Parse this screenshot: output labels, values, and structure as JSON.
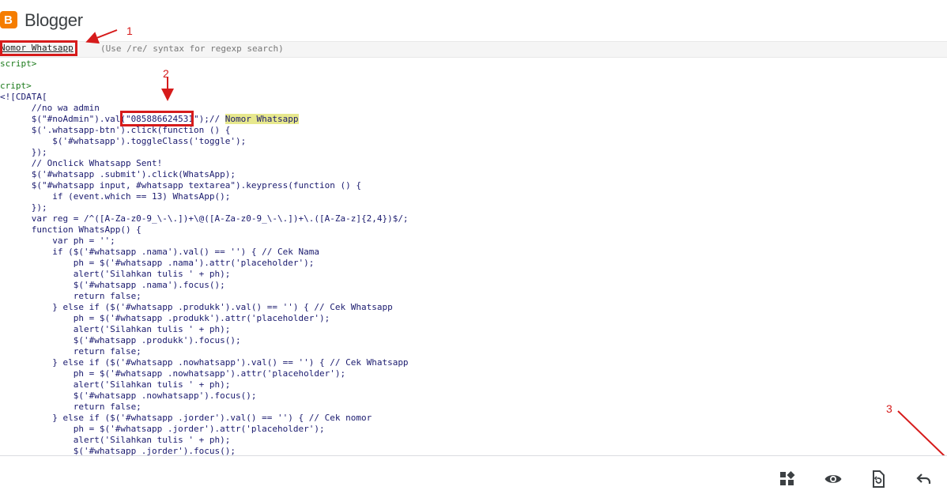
{
  "header": {
    "app_title": "Blogger",
    "logo_letter": "B"
  },
  "search": {
    "value": "Nomor Whatsapp",
    "hint": "(Use /re/ syntax for regexp search)"
  },
  "annotations": {
    "label_1": "1",
    "label_2": "2",
    "label_3": "3",
    "color": "#d61b1b"
  },
  "code_lines": [
    "script>",
    "",
    "cript>",
    "<![CDATA[",
    "      //no wa admin",
    "      $(\"#noAdmin\").val(\"085886624531\");// ",
    "      $('.whatsapp-btn').click(function () {",
    "          $('#whatsapp').toggleClass('toggle');",
    "      });",
    "      // Onclick Whatsapp Sent!",
    "      $('#whatsapp .submit').click(WhatsApp);",
    "      $(\"#whatsapp input, #whatsapp textarea\").keypress(function () {",
    "          if (event.which == 13) WhatsApp();",
    "      });",
    "      var reg = /^([A-Za-z0-9_\\-\\.])+\\@([A-Za-z0-9_\\-\\.])+\\.([A-Za-z]{2,4})$/;",
    "      function WhatsApp() {",
    "          var ph = '';",
    "          if ($('#whatsapp .nama').val() == '') { // Cek Nama",
    "              ph = $('#whatsapp .nama').attr('placeholder');",
    "              alert('Silahkan tulis ' + ph);",
    "              $('#whatsapp .nama').focus();",
    "              return false;",
    "          } else if ($('#whatsapp .produkk').val() == '') { // Cek Whatsapp",
    "              ph = $('#whatsapp .produkk').attr('placeholder');",
    "              alert('Silahkan tulis ' + ph);",
    "              $('#whatsapp .produkk').focus();",
    "              return false;",
    "          } else if ($('#whatsapp .nowhatsapp').val() == '') { // Cek Whatsapp",
    "              ph = $('#whatsapp .nowhatsapp').attr('placeholder');",
    "              alert('Silahkan tulis ' + ph);",
    "              $('#whatsapp .nowhatsapp').focus();",
    "              return false;",
    "          } else if ($('#whatsapp .jorder').val() == '') { // Cek nomor",
    "              ph = $('#whatsapp .jorder').attr('placeholder');",
    "              alert('Silahkan tulis ' + ph);",
    "              $('#whatsapp .jorder').focus();"
  ],
  "highlight_text": "Nomor Whatsapp",
  "footer_icons": [
    "layout-icon",
    "preview-icon",
    "revert-icon",
    "undo-icon"
  ]
}
